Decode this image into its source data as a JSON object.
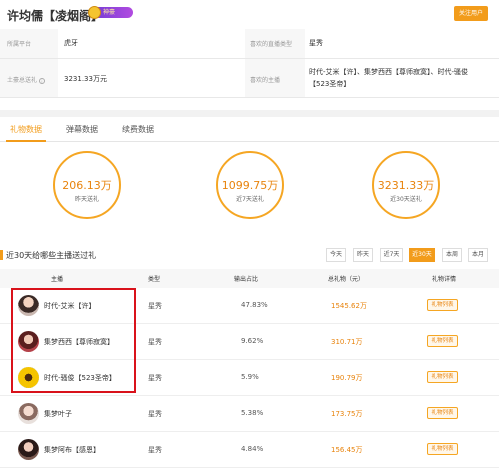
{
  "header": {
    "title": "许均儒【凌烟阁】",
    "badge": "神豪",
    "follow_label": "关注用户"
  },
  "info": {
    "platform_label": "所属平台",
    "platform_value": "虎牙",
    "fav_type_label": "喜欢的直播类型",
    "fav_type_value": "星秀",
    "total_gift_label": "土豪总送礼",
    "total_gift_value": "3231.33万元",
    "fav_anchor_label": "喜欢的主播",
    "fav_anchor_line1": "时代-艾米【许】、集梦西西【尊师寂寞】、时代-骚俊",
    "fav_anchor_line2": "【523圣帝】"
  },
  "tabs": [
    {
      "label": "礼物数据"
    },
    {
      "label": "弹幕数据"
    },
    {
      "label": "续费数据"
    }
  ],
  "stats": [
    {
      "value": "206.13万",
      "caption": "昨天送礼"
    },
    {
      "value": "1099.75万",
      "caption": "近7天送礼"
    },
    {
      "value": "3231.33万",
      "caption": "近30天送礼"
    }
  ],
  "section": {
    "title": "近30天给哪些主播送过礼"
  },
  "filters": [
    {
      "label": "今天",
      "active": false
    },
    {
      "label": "昨天",
      "active": false
    },
    {
      "label": "近7天",
      "active": false
    },
    {
      "label": "近30天",
      "active": true
    },
    {
      "label": "本周",
      "active": false
    },
    {
      "label": "本月",
      "active": false
    }
  ],
  "table": {
    "headers": [
      "主播",
      "类型",
      "输出占比",
      "总礼物（元）",
      "礼物详情"
    ],
    "rows": [
      {
        "name": "时代-艾米【许】",
        "type": "星秀",
        "ratio": "47.83%",
        "gift": "1545.62万",
        "detail": "礼物列表"
      },
      {
        "name": "集梦西西【尊师寂寞】",
        "type": "星秀",
        "ratio": "9.62%",
        "gift": "310.71万",
        "detail": "礼物列表"
      },
      {
        "name": "时代-骚俊【523圣帝】",
        "type": "星秀",
        "ratio": "5.9%",
        "gift": "190.79万",
        "detail": "礼物列表"
      },
      {
        "name": "集梦叶子",
        "type": "星秀",
        "ratio": "5.38%",
        "gift": "173.75万",
        "detail": "礼物列表"
      },
      {
        "name": "集梦阿布【感恩】",
        "type": "星秀",
        "ratio": "4.84%",
        "gift": "156.45万",
        "detail": "礼物列表"
      }
    ]
  },
  "colors": {
    "accent": "#f29c1b",
    "value_orange": "#e8830c",
    "highlight_red": "#d9121b"
  }
}
